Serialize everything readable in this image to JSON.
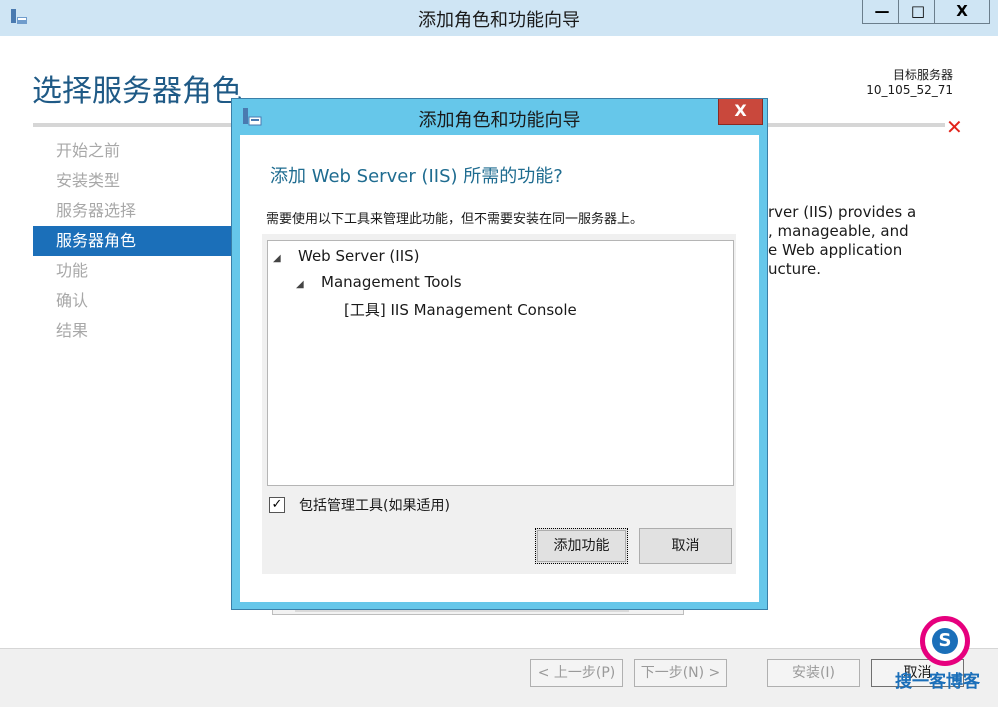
{
  "window": {
    "title": "添加角色和功能向导",
    "controls": {
      "minimize": "—",
      "maximize": "□",
      "close": "X"
    }
  },
  "page": {
    "title": "选择服务器角色",
    "destination_label": "目标服务器",
    "destination_value": "10_105_52_71"
  },
  "nav": {
    "items": [
      {
        "label": "开始之前",
        "active": false
      },
      {
        "label": "安装类型",
        "active": false
      },
      {
        "label": "服务器选择",
        "active": false
      },
      {
        "label": "服务器角色",
        "active": true
      },
      {
        "label": "功能",
        "active": false
      },
      {
        "label": "确认",
        "active": false
      },
      {
        "label": "结果",
        "active": false
      }
    ]
  },
  "description": {
    "lines": [
      "rver (IIS) provides a",
      ", manageable, and",
      "e Web application",
      "ucture."
    ]
  },
  "footer": {
    "prev": "< 上一步(P)",
    "next": "下一步(N) >",
    "install": "安装(I)",
    "cancel": "取消"
  },
  "watermark": {
    "text": "搜一客博客",
    "logo_letter": "S"
  },
  "dialog": {
    "title": "添加角色和功能向导",
    "close": "X",
    "heading": "添加 Web Server (IIS) 所需的功能?",
    "description": "需要使用以下工具来管理此功能，但不需要安装在同一服务器上。",
    "tree": [
      {
        "label": "Web Server (IIS)",
        "level": 0,
        "expanded": true
      },
      {
        "label": "Management Tools",
        "level": 1,
        "expanded": true
      },
      {
        "label": "[工具] IIS Management Console",
        "level": 2,
        "expanded": false
      }
    ],
    "include_tools_label": "包括管理工具(如果适用)",
    "include_tools_checked": true,
    "add_button": "添加功能",
    "cancel_button": "取消"
  },
  "colors": {
    "accent": "#1b6fb9",
    "title_text": "#1f5a86",
    "dialog_frame": "#66c7ea",
    "close_red": "#c9483c"
  },
  "icons": [
    "server-manager-icon",
    "minimize-icon",
    "maximize-icon",
    "close-icon",
    "error-x-icon",
    "expand-arrow-icon",
    "checkmark-icon"
  ]
}
